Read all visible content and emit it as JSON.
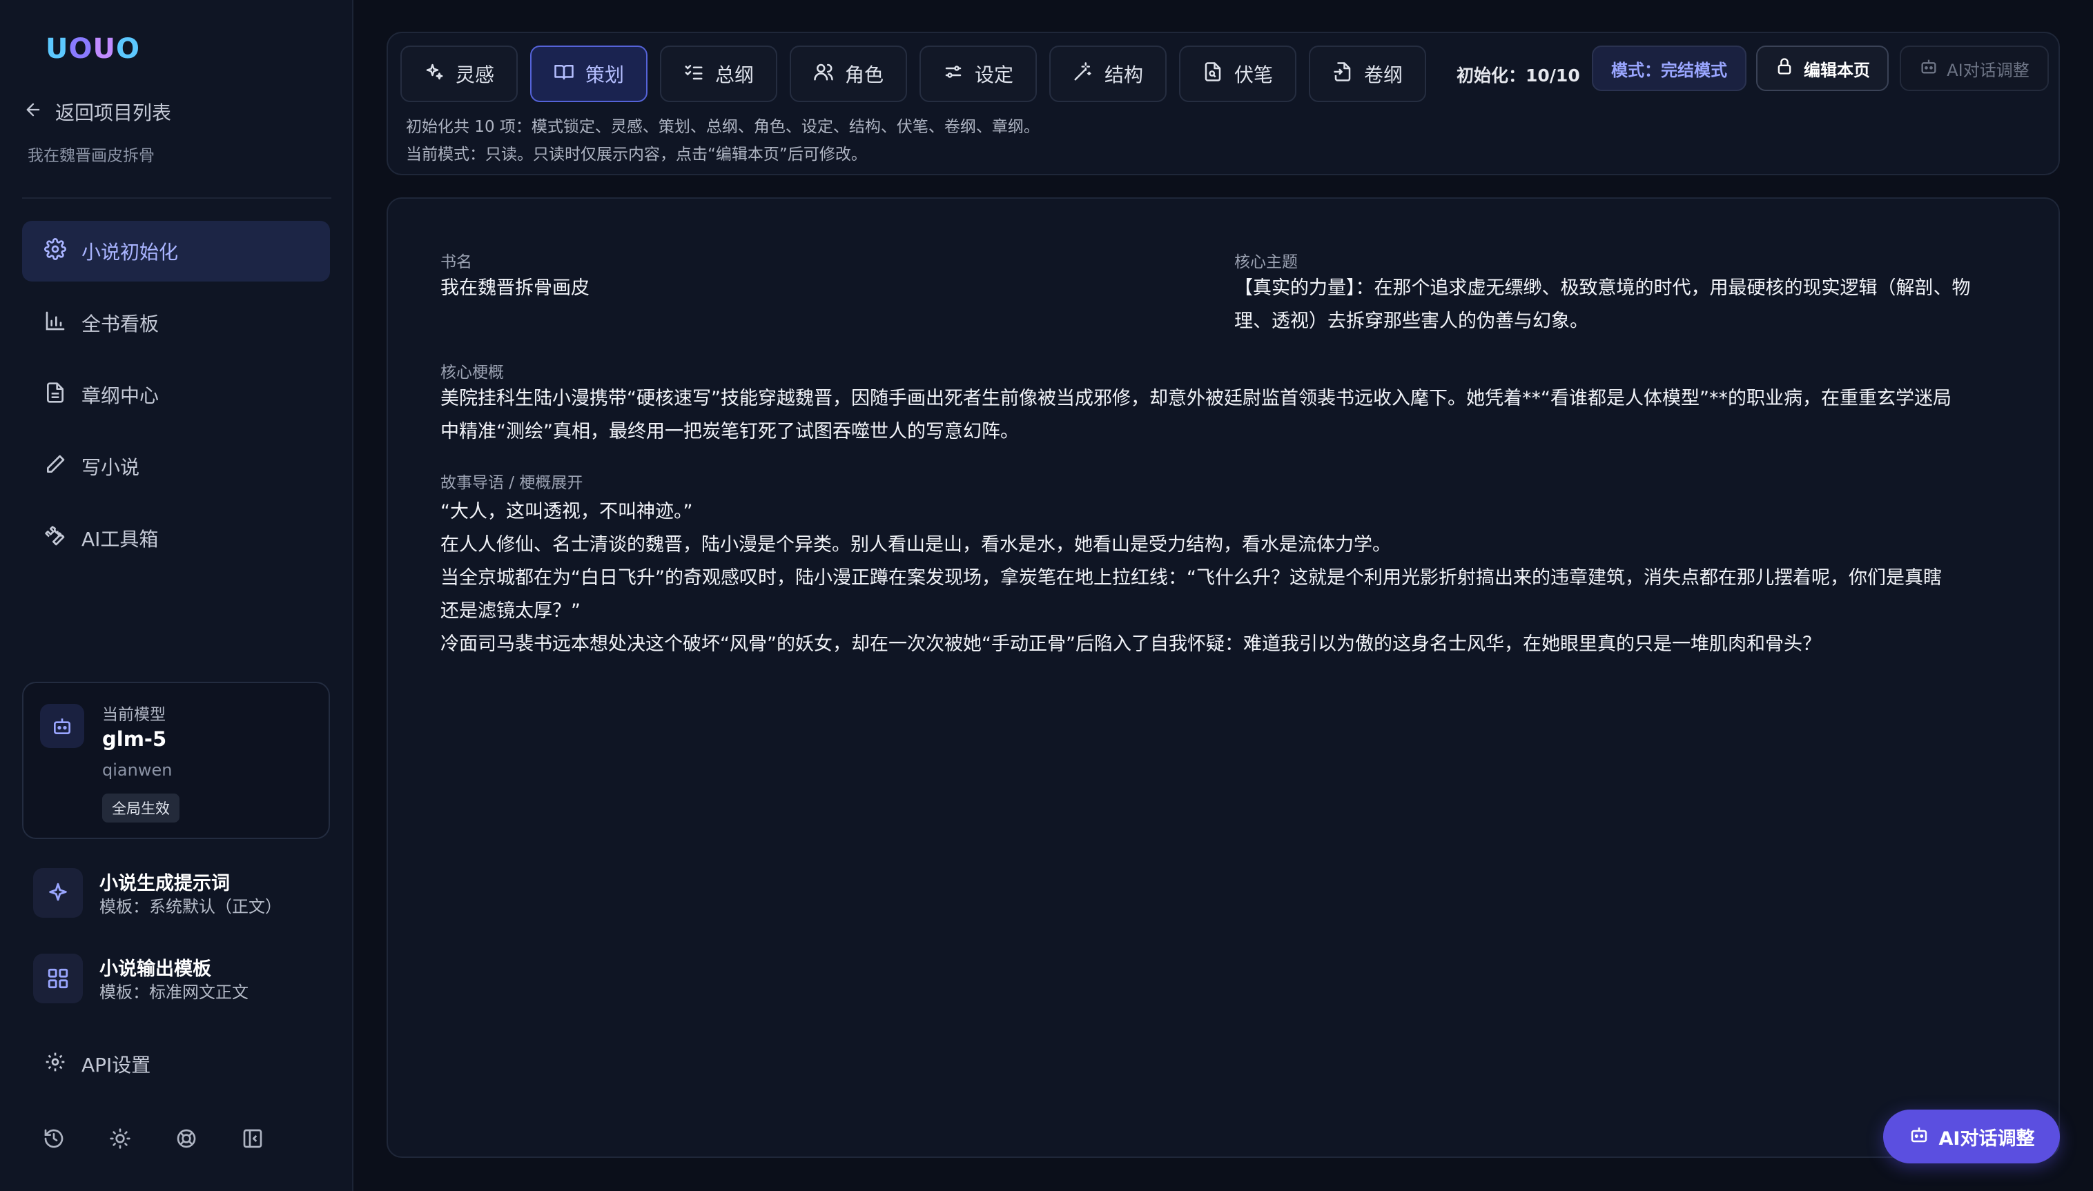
{
  "app": {
    "logo": "UOUO",
    "back_label": "返回项目列表",
    "project_name": "我在魏晋画皮拆骨"
  },
  "nav": {
    "items": [
      {
        "label": "小说初始化",
        "icon": "gear-icon",
        "active": true
      },
      {
        "label": "全书看板",
        "icon": "bar-chart-icon",
        "active": false
      },
      {
        "label": "章纲中心",
        "icon": "document-icon",
        "active": false
      },
      {
        "label": "写小说",
        "icon": "pen-icon",
        "active": false
      },
      {
        "label": "AI工具箱",
        "icon": "wrench-icon",
        "active": false
      }
    ]
  },
  "model": {
    "label": "当前模型",
    "name": "glm-5",
    "provider": "qianwen",
    "scope_badge": "全局生效"
  },
  "prompt_tool": {
    "title": "小说生成提示词",
    "subtitle": "模板：系统默认（正文）"
  },
  "output_tool": {
    "title": "小说输出模板",
    "subtitle": "模板：标准网文正文"
  },
  "api_settings_label": "API设置",
  "toolbar": {
    "tabs": [
      {
        "label": "灵感",
        "icon": "sparkle-icon"
      },
      {
        "label": "策划",
        "icon": "book-icon"
      },
      {
        "label": "总纲",
        "icon": "list-check-icon"
      },
      {
        "label": "角色",
        "icon": "users-icon"
      },
      {
        "label": "设定",
        "icon": "sliders-icon"
      },
      {
        "label": "结构",
        "icon": "wand-icon"
      },
      {
        "label": "伏笔",
        "icon": "file-search-icon"
      },
      {
        "label": "卷纲",
        "icon": "file-arrow-icon"
      }
    ],
    "active_tab": "策划",
    "init_count": "初始化：10/10",
    "mode_label": "模式：完结模式",
    "edit_label": "编辑本页",
    "ai_adjust_label": "AI对话调整",
    "hint_items": "初始化共 10 项：模式锁定、灵感、策划、总纲、角色、设定、结构、伏笔、卷纲、章纲。",
    "hint_mode": "当前模式：只读。只读时仅展示内容，点击“编辑本页”后可修改。"
  },
  "content": {
    "book_name_label": "书名",
    "book_name": "我在魏晋拆骨画皮",
    "theme_label": "核心主题",
    "theme_line1": "【真实的力量】：在那个追求虚无缥缈、极致意境的时代，用最硬核的现实逻辑（解剖、物",
    "theme_line2": "理、透视）去拆穿那些害人的伪善与幻象。",
    "summary_label": "核心梗概",
    "summary_line1": "美院挂科生陆小漫携带“硬核速写”技能穿越魏晋，因随手画出死者生前像被当成邪修，却意外被廷尉监首领裴书远收入麾下。她凭着**“看谁都是人体模型”**的职业病，在重重玄学迷局",
    "summary_line2": "中精准“测绘”真相，最终用一把炭笔钉死了试图吞噬世人的写意幻阵。",
    "story_label": "故事导语 / 梗概展开",
    "story_lines": [
      "“大人，这叫透视，不叫神迹。”",
      "在人人修仙、名士清谈的魏晋，陆小漫是个异类。别人看山是山，看水是水，她看山是受力结构，看水是流体力学。",
      "当全京城都在为“白日飞升”的奇观感叹时，陆小漫正蹲在案发现场，拿炭笔在地上拉红线：“飞什么升？这就是个利用光影折射搞出来的违章建筑，消失点都在那儿摆着呢，你们是真瞎",
      "还是滤镜太厚？”",
      "冷面司马裴书远本想处决这个破坏“风骨”的妖女，却在一次次被她“手动正骨”后陷入了自我怀疑：难道我引以为傲的这身名士风华，在她眼里真的只是一堆肌肉和骨头？"
    ]
  },
  "fab_label": "AI对话调整",
  "colors": {
    "accent": "#5b4fe0",
    "active_tab_border": "#5563d8",
    "background": "#0b0f1a",
    "panel": "#0f1524"
  }
}
